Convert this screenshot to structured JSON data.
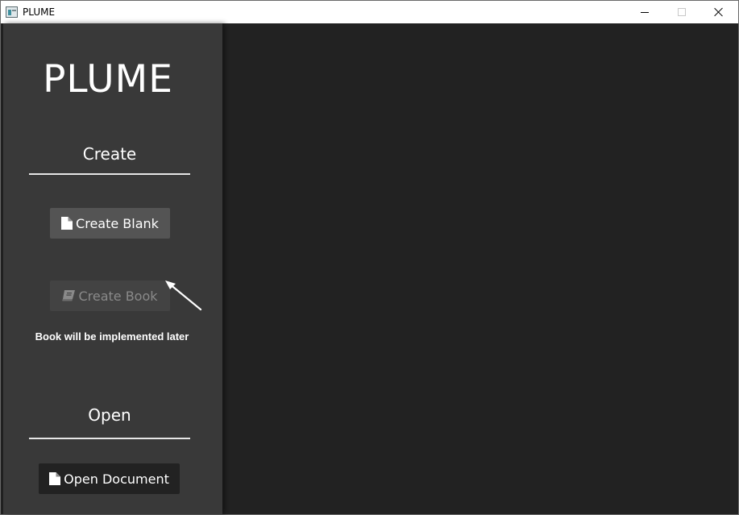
{
  "window": {
    "title": "PLUME",
    "controls": {
      "minimize": "minimize",
      "maximize": "maximize",
      "close": "close"
    }
  },
  "sidebar": {
    "logo": "PLUME",
    "create_section": {
      "title": "Create",
      "create_blank_label": "Create Blank",
      "create_book_label": "Create Book",
      "create_book_note": "Book will be implemented later"
    },
    "open_section": {
      "title": "Open",
      "open_document_label": "Open Document"
    }
  },
  "icons": {
    "app": "app-window-icon",
    "create_blank": "file-icon",
    "create_book": "book-icon",
    "open_document": "file-icon"
  },
  "colors": {
    "sidebar_bg": "#393939",
    "main_bg": "#222222",
    "button_bg": "#545454",
    "disabled_button_bg": "#434343",
    "disabled_text": "#8a8a8a",
    "text": "#ffffff"
  }
}
